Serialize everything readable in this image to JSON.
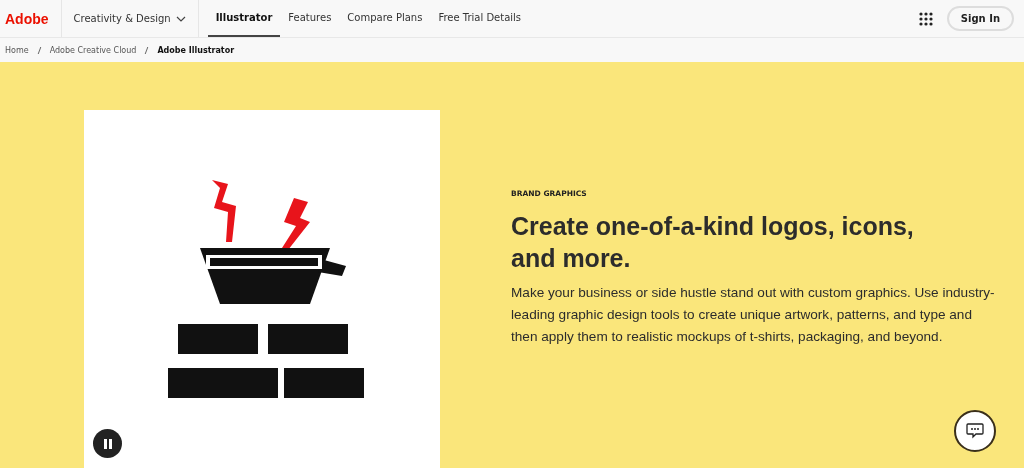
{
  "header": {
    "logo": "Adobe",
    "menu": {
      "label": "Creativity & Design"
    },
    "tabs": [
      {
        "label": "Illustrator",
        "selected": true
      },
      {
        "label": "Features",
        "selected": false
      },
      {
        "label": "Compare Plans",
        "selected": false
      },
      {
        "label": "Free Trial Details",
        "selected": false
      }
    ],
    "sign_in": "Sign In"
  },
  "breadcrumb": [
    {
      "label": "Home",
      "current": false
    },
    {
      "label": "Adobe Creative Cloud",
      "current": false
    },
    {
      "label": "Adobe Illustrator",
      "current": true
    }
  ],
  "hero": {
    "media": {
      "kind": "picture",
      "playing": true
    },
    "eyebrow": "BRAND GRAPHICS",
    "title": "Create one-of-a-kind logos, icons, and more.",
    "body": "Make your business or side hustle stand out with custom graphics. Use industry-leading graphic design tools to create unique artwork, patterns, and type and then apply them to realistic mockups of t-shirts, packaging, and beyond."
  }
}
